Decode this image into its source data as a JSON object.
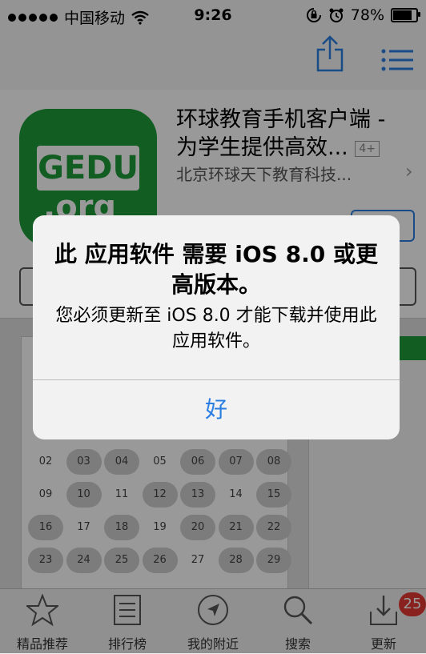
{
  "status_bar": {
    "carrier": "中国移动",
    "time": "9:26",
    "battery": "78%",
    "battery_level": 0.78
  },
  "app": {
    "title_line1": "环球教育手机客户端 -",
    "title_line2": "为学生提供高效...",
    "age_rating": "4+",
    "developer": "北京环球天下教育科技...",
    "logo_text": "GEDU",
    "logo_sub": ".org"
  },
  "calendar": {
    "days": [
      {
        "label": "02",
        "on": false
      },
      {
        "label": "03",
        "on": true
      },
      {
        "label": "04",
        "on": true
      },
      {
        "label": "05",
        "on": false
      },
      {
        "label": "06",
        "on": true
      },
      {
        "label": "07",
        "on": true
      },
      {
        "label": "08",
        "on": true
      },
      {
        "label": "09",
        "on": false
      },
      {
        "label": "10",
        "on": true
      },
      {
        "label": "11",
        "on": false
      },
      {
        "label": "12",
        "on": true
      },
      {
        "label": "13",
        "on": true
      },
      {
        "label": "14",
        "on": false
      },
      {
        "label": "15",
        "on": true
      },
      {
        "label": "16",
        "on": true
      },
      {
        "label": "17",
        "on": false
      },
      {
        "label": "18",
        "on": true
      },
      {
        "label": "19",
        "on": false
      },
      {
        "label": "20",
        "on": true
      },
      {
        "label": "21",
        "on": true
      },
      {
        "label": "22",
        "on": true
      },
      {
        "label": "23",
        "on": true
      },
      {
        "label": "24",
        "on": true
      },
      {
        "label": "25",
        "on": true
      },
      {
        "label": "26",
        "on": true
      },
      {
        "label": "27",
        "on": false
      },
      {
        "label": "28",
        "on": true
      },
      {
        "label": "29",
        "on": true
      }
    ]
  },
  "alert": {
    "title": "此 应用软件 需要 iOS 8.0 或更高版本。",
    "message": "您必须更新至 iOS 8.0 才能下载并使用此 应用软件。",
    "ok_label": "好"
  },
  "tab_bar": {
    "items": [
      {
        "label": "精品推荐",
        "icon": "star-icon"
      },
      {
        "label": "排行榜",
        "icon": "list-icon"
      },
      {
        "label": "我的附近",
        "icon": "location-icon"
      },
      {
        "label": "搜索",
        "icon": "search-icon"
      },
      {
        "label": "更新",
        "icon": "update-icon"
      }
    ],
    "update_badge": "25"
  },
  "colors": {
    "accent": "#2a7de1",
    "brand_green": "#1e9c3a",
    "badge": "#e53935"
  }
}
